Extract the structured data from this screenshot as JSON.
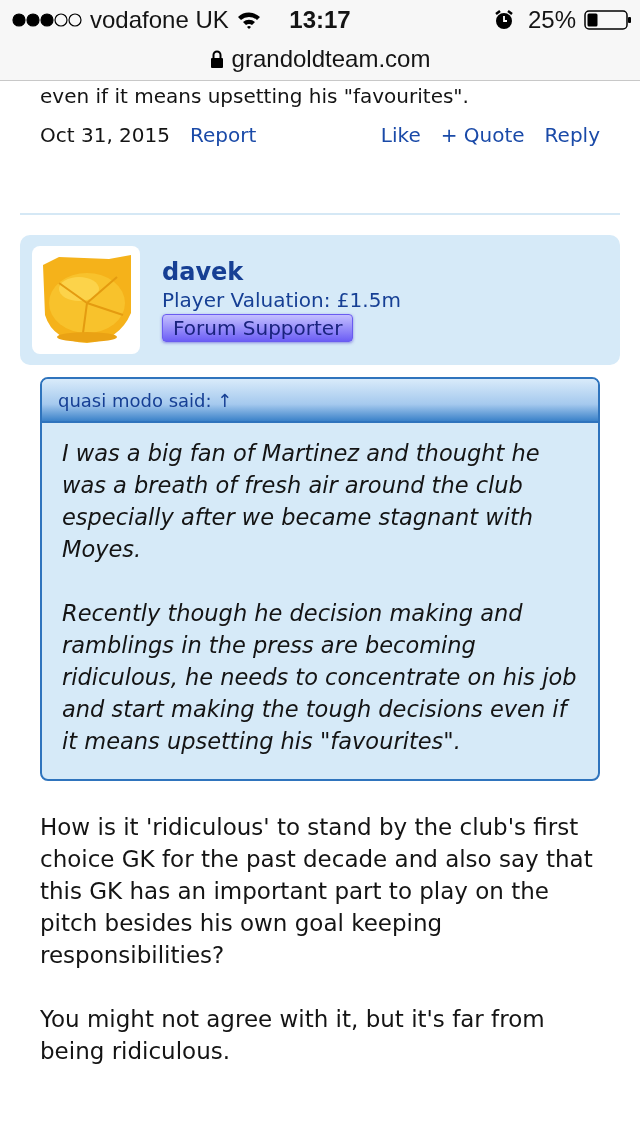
{
  "status_bar": {
    "carrier": "vodafone UK",
    "time": "13:17",
    "battery": "25%"
  },
  "address_bar": {
    "url": "grandoldteam.com"
  },
  "previous_post": {
    "cut_text": "even if it means upsetting his \"favourites\".",
    "date": "Oct 31, 2015",
    "actions_left": [
      "Report"
    ],
    "actions_right": [
      "Like",
      "+ Quote",
      "Reply"
    ]
  },
  "post": {
    "author": {
      "name": "davek",
      "valuation": "Player Valuation: £1.5m",
      "badge": "Forum Supporter"
    },
    "quote": {
      "header": "quasi modo said: ↑",
      "paragraphs": [
        "I was a big fan of Martinez and thought he was a breath of fresh air around the club especially after we became stagnant with Moyes.",
        "Recently though he decision making and ramblings in the press are becoming ridiculous, he needs to concentrate on his job and start making the tough decisions even if it means upsetting his \"favourites\"."
      ]
    },
    "paragraphs": [
      "How is it 'ridiculous' to stand by the club's first choice GK for the past decade and also say that this GK has an important part to play on the pitch besides his own goal keeping responsibilities?",
      "You might not agree with it, but it's far from being ridiculous."
    ]
  }
}
